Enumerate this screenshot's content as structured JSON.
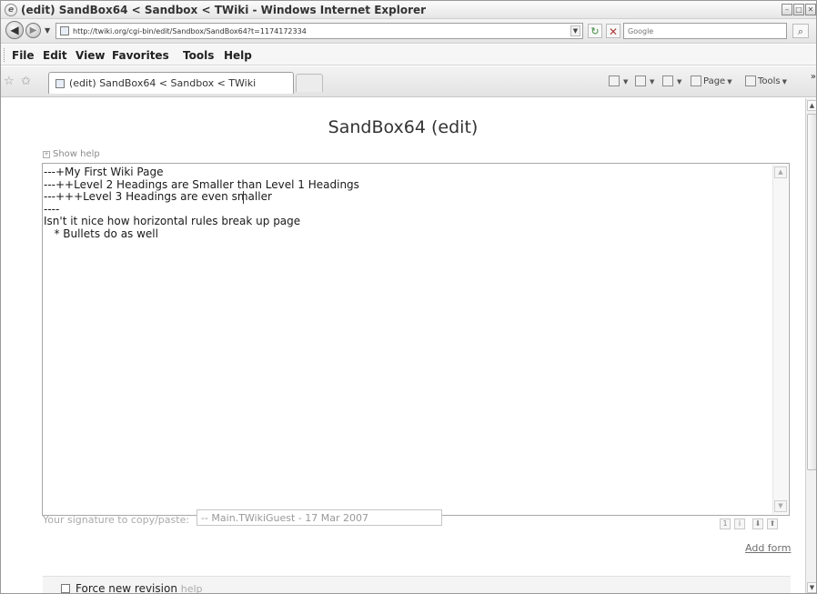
{
  "window": {
    "title": "(edit) SandBox64 < Sandbox < TWiki - Windows Internet Explorer",
    "controls": [
      "–",
      "□",
      "✕"
    ]
  },
  "address": {
    "url": "http://twiki.org/cgi-bin/edit/Sandbox/SandBox64?t=1174172334",
    "search_placeholder": "Google"
  },
  "menu": {
    "items": [
      "File",
      "Edit",
      "View",
      "Favorites",
      "Tools",
      "Help"
    ]
  },
  "tab": {
    "label": "(edit) SandBox64 < Sandbox < TWiki"
  },
  "commands": {
    "page": "Page",
    "tools": "Tools"
  },
  "page": {
    "title": "SandBox64 (edit)",
    "show_help": "Show help",
    "editor_lines": [
      "---+My First Wiki Page",
      "---++Level 2 Headings are Smaller than Level 1 Headings",
      "---+++Level 3 Headings are even smaller",
      "----",
      "Isn't it nice how horizontal rules break up page",
      "   * Bullets do as well"
    ],
    "signature_label": "Your signature to copy/paste:",
    "signature_value": "-- Main.TWikiGuest - 17 Mar 2007",
    "add_form": "Add form",
    "force_revision": "Force new revision",
    "force_revision_help": "help"
  },
  "icons": {
    "app": "ie-icon",
    "back": "back-arrow-icon",
    "forward": "forward-arrow-icon",
    "refresh": "refresh-icon",
    "stop": "stop-icon",
    "search": "search-icon",
    "favorites": "favorites-star-icon",
    "add_favorite": "add-favorite-icon",
    "home": "home-icon",
    "feeds": "feeds-icon",
    "print": "print-icon"
  }
}
